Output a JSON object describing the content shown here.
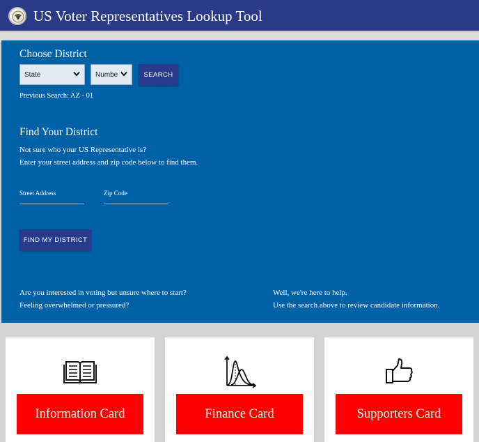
{
  "header": {
    "title": "US Voter Representatives Lookup Tool",
    "logo": "us-seal-icon"
  },
  "choose_district": {
    "heading": "Choose District",
    "state_select": "State",
    "number_select": "Numbe",
    "search_button": "SEARCH",
    "previous_search": "Previous Search: AZ - 01"
  },
  "find_district": {
    "heading": "Find Your District",
    "line1": "Not sure who your US Representative is?",
    "line2": "Enter your street address and zip code below to find them.",
    "street_label": "Street Address",
    "zip_label": "Zip Code",
    "button": "FIND MY DISTRICT"
  },
  "info": {
    "left_line1": "Are you interested in voting but unsure where to start?",
    "left_line2": "Feeling overwhelmed or pressured?",
    "right_line1": "Well, we're here to help.",
    "right_line2": "Use the search above to review candidate information."
  },
  "cards": [
    {
      "label": "Information Card",
      "icon": "open-book-icon"
    },
    {
      "label": "Finance Card",
      "icon": "distribution-chart-icon"
    },
    {
      "label": "Supporters Card",
      "icon": "thumbs-up-icon"
    }
  ],
  "colors": {
    "header": "#2b3a86",
    "panel": "#0061a7",
    "button": "#273a8c",
    "card_button": "#ff0000"
  }
}
